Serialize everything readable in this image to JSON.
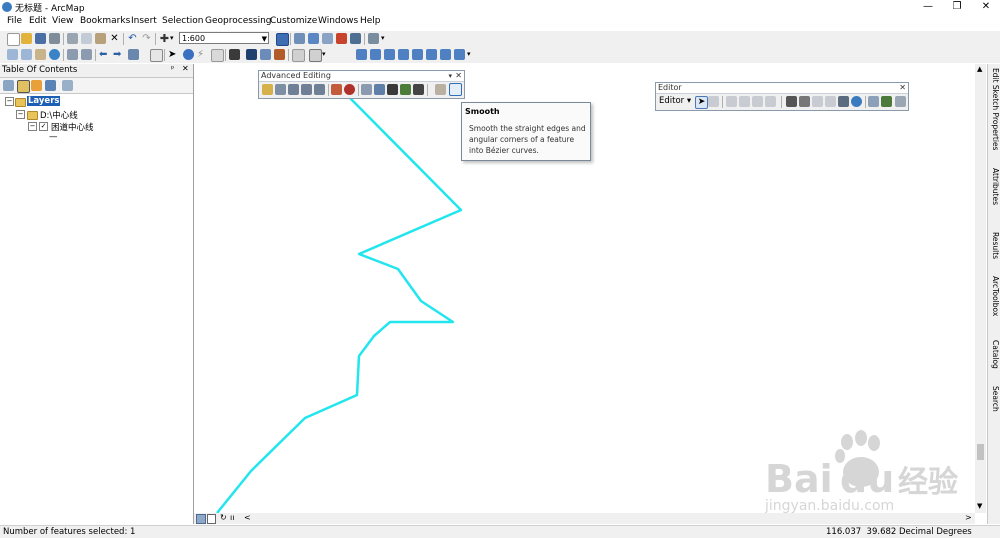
{
  "titlebar": {
    "title": "无标题 - ArcMap",
    "minimize": "—",
    "maximize": "❐",
    "close": "✕"
  },
  "menubar": [
    "File",
    "Edit",
    "View",
    "Bookmarks",
    "Insert",
    "Selection",
    "Geoprocessing",
    "Customize",
    "Windows",
    "Help"
  ],
  "toolbar": {
    "scale_value": "1:600"
  },
  "toc": {
    "title": "Table Of Contents",
    "pin": "ᵖ",
    "close": "✕",
    "layers_label": "Layers",
    "folder_label": "D:\\中心线",
    "layer_label": "困道中心线",
    "legend_symbol": "—"
  },
  "advanced_editing": {
    "title": "Advanced Editing",
    "tooltip": {
      "title": "Smooth",
      "description": "Smooth the straight edges and angular corners of a feature into Bézier curves."
    }
  },
  "editor": {
    "title": "Editor",
    "menu_label": "Editor ▾"
  },
  "dock_tabs": [
    "Edit Sketch Properties",
    "Attributes",
    "Results",
    "ArcToolbox",
    "Catalog",
    "Search"
  ],
  "statusbar": {
    "selection": "Number of features selected: 1",
    "coordinates": "116.037  39.682 Decimal Degrees"
  },
  "watermark": {
    "brand": "Bai",
    "brand2": "du",
    "cn": "经验",
    "url": "jingyan.baidu.com"
  },
  "colors": {
    "line": "#22e5ee",
    "watermark": "#d6d6d6"
  }
}
